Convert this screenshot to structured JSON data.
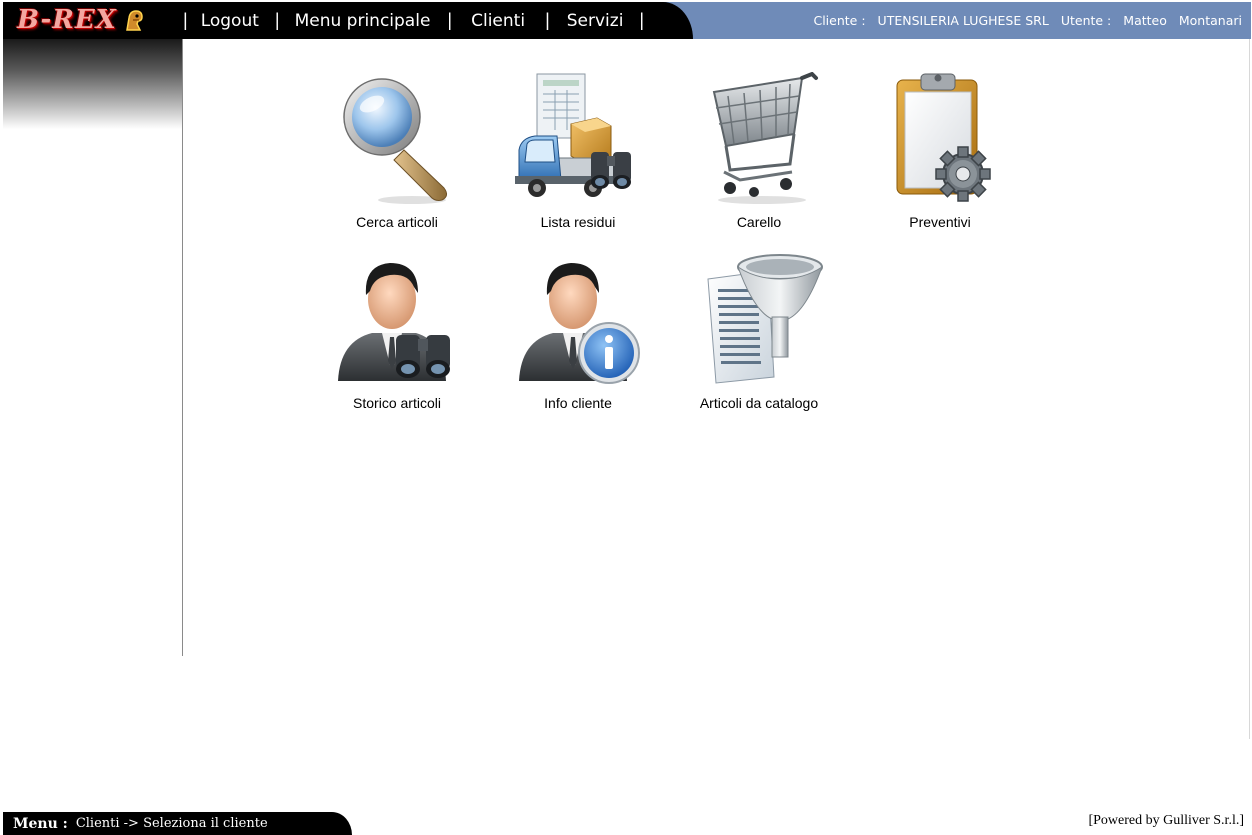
{
  "logo": {
    "text": "B-REX"
  },
  "nav": {
    "separator": "|",
    "items": [
      {
        "id": "logout",
        "label": "Logout"
      },
      {
        "id": "menu-principale",
        "label": "Menu principale"
      },
      {
        "id": "clienti",
        "label": "Clienti"
      },
      {
        "id": "servizi",
        "label": "Servizi"
      }
    ]
  },
  "user_info": {
    "client_label": "Cliente :",
    "client_value": "UTENSILERIA LUGHESE SRL",
    "user_label": "Utente :",
    "user_first_name": "Matteo",
    "user_last_name": "Montanari"
  },
  "tiles": [
    {
      "label": "Cerca articoli",
      "icon": "magnifier-icon"
    },
    {
      "label": "Lista residui",
      "icon": "truck-binoculars-icon"
    },
    {
      "label": "Carello",
      "icon": "shopping-cart-icon"
    },
    {
      "label": "Preventivi",
      "icon": "clipboard-gear-icon"
    },
    {
      "label": "Storico articoli",
      "icon": "user-binoculars-icon"
    },
    {
      "label": "Info cliente",
      "icon": "user-info-icon"
    },
    {
      "label": "Articoli da catalogo",
      "icon": "catalog-funnel-icon"
    }
  ],
  "footer": {
    "menu_label": "Menu :",
    "path": "Clienti -> Seleziona il cliente",
    "powered_by": "[Powered by Gulliver S.r.l.]"
  },
  "colors": {
    "topbar_black": "#000000",
    "topbar_blue": "#6f8bb8",
    "logo_red": "#c00000"
  }
}
